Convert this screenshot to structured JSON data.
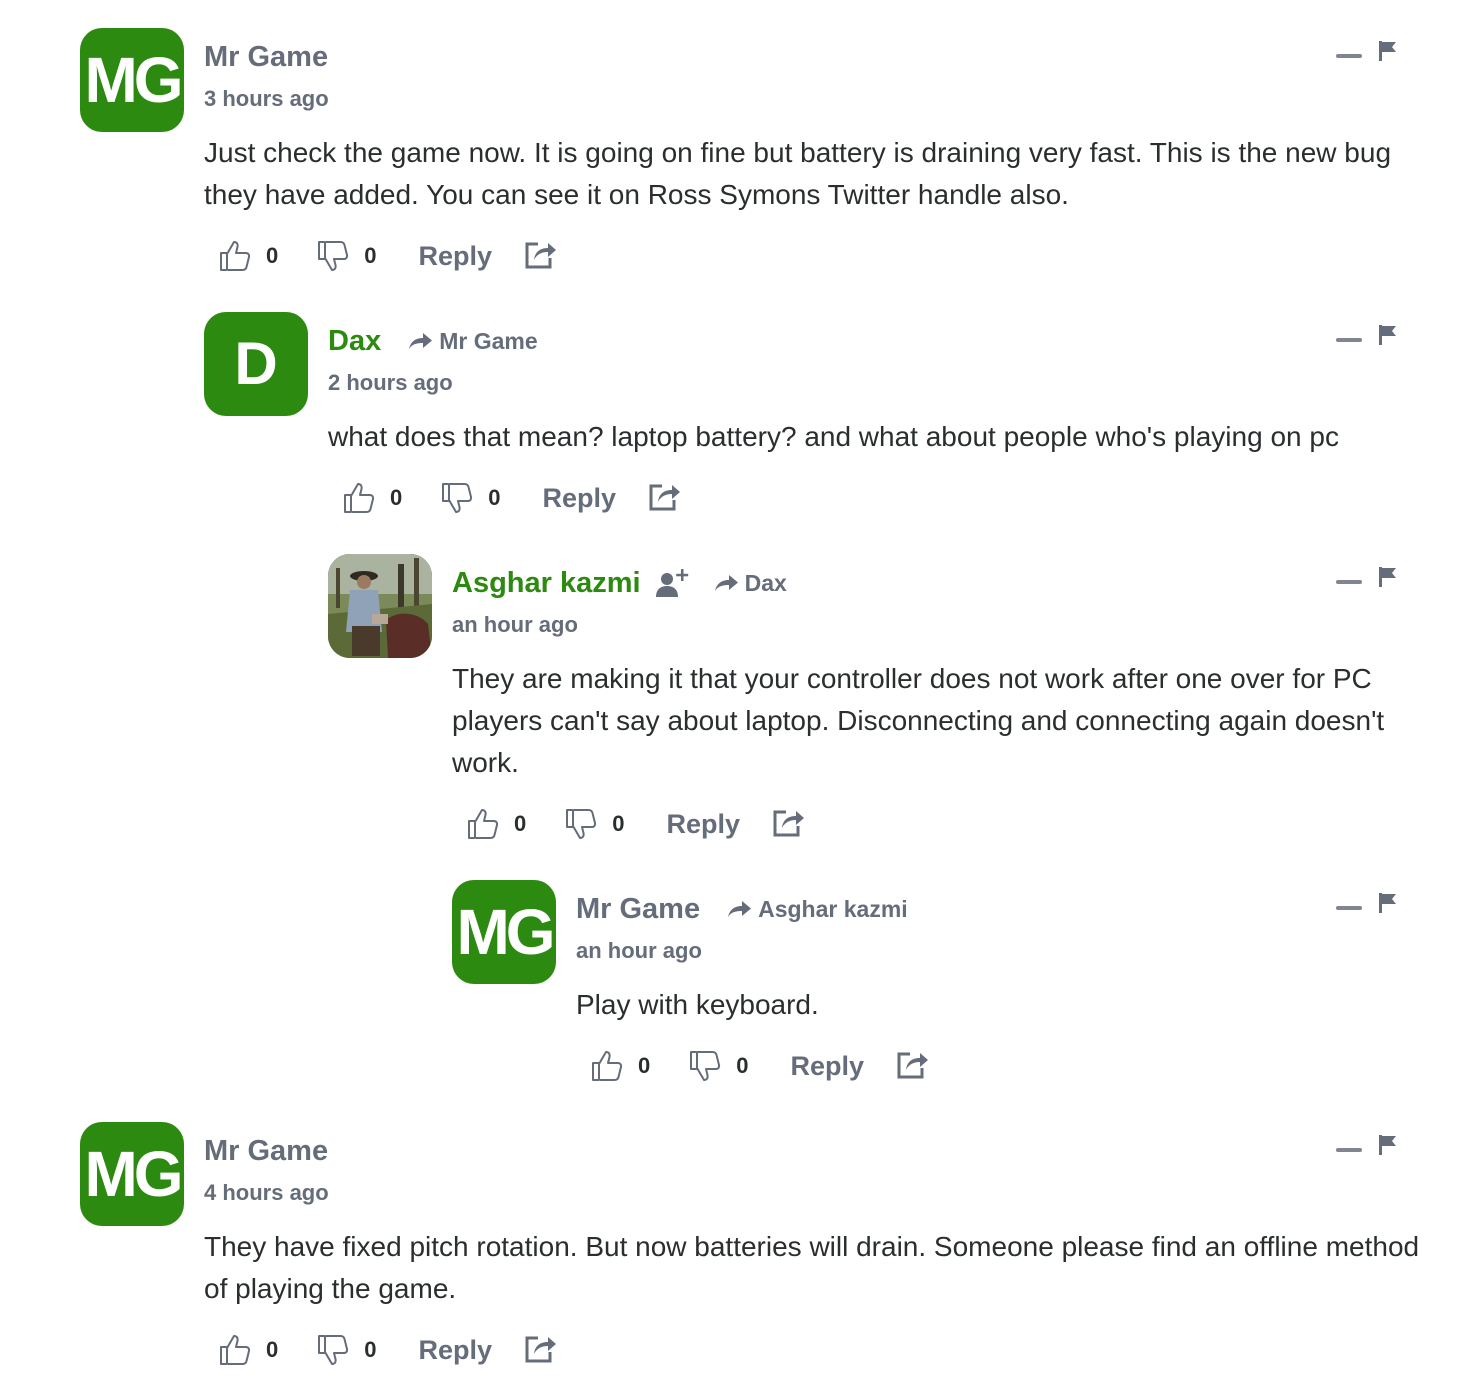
{
  "comments": [
    {
      "author": "Mr Game",
      "initials": "MG",
      "time": "3 hours ago",
      "text": "Just check the game now. It is going on fine but battery is draining very fast. This is the new bug they have added. You can see it on Ross Symons Twitter handle also.",
      "likes": "0",
      "dislikes": "0",
      "reply_label": "Reply"
    },
    {
      "author": "Dax",
      "initials": "D",
      "reply_to": "Mr Game",
      "time": "2 hours ago",
      "text": "what does that mean? laptop battery? and what about people who's playing on pc",
      "likes": "0",
      "dislikes": "0",
      "reply_label": "Reply"
    },
    {
      "author": "Asghar kazmi",
      "reply_to": "Dax",
      "time": "an hour ago",
      "text": "They are making it that your controller does not work after one over for PC players can't say about laptop. Disconnecting and connecting again doesn't work.",
      "likes": "0",
      "dislikes": "0",
      "reply_label": "Reply"
    },
    {
      "author": "Mr Game",
      "initials": "MG",
      "reply_to": "Asghar kazmi",
      "time": "an hour ago",
      "text": "Play with keyboard.",
      "likes": "0",
      "dislikes": "0",
      "reply_label": "Reply"
    },
    {
      "author": "Mr Game",
      "initials": "MG",
      "time": "4 hours ago",
      "text": "They have fixed pitch rotation. But now batteries will drain. Someone please find an offline method of playing the game.",
      "likes": "0",
      "dislikes": "0",
      "reply_label": "Reply"
    }
  ],
  "colors": {
    "accent_green": "#2b8a0f",
    "muted_text": "#656c7a",
    "body_text": "#2a2e2e"
  },
  "icons": [
    "thumbs-up-icon",
    "thumbs-down-icon",
    "share-icon",
    "collapse-icon",
    "flag-icon",
    "reply-arrow-icon",
    "follow-user-icon"
  ]
}
